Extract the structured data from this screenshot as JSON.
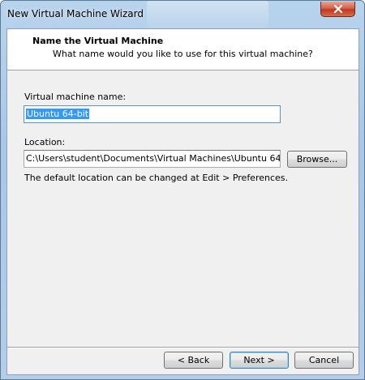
{
  "window": {
    "title": "New Virtual Machine Wizard"
  },
  "header": {
    "title": "Name the Virtual Machine",
    "subtitle": "What name would you like to use for this virtual machine?"
  },
  "form": {
    "vm_name_label": "Virtual machine name:",
    "vm_name_value": "Ubuntu 64-bit",
    "location_label": "Location:",
    "location_value": "C:\\Users\\student\\Documents\\Virtual Machines\\Ubuntu 64",
    "browse_label": "Browse...",
    "hint": "The default location can be changed at Edit > Preferences."
  },
  "footer": {
    "back_label": "< Back",
    "next_label": "Next >",
    "cancel_label": "Cancel"
  },
  "colors": {
    "selection": "#3399ff",
    "close_button": "#c0391f"
  }
}
